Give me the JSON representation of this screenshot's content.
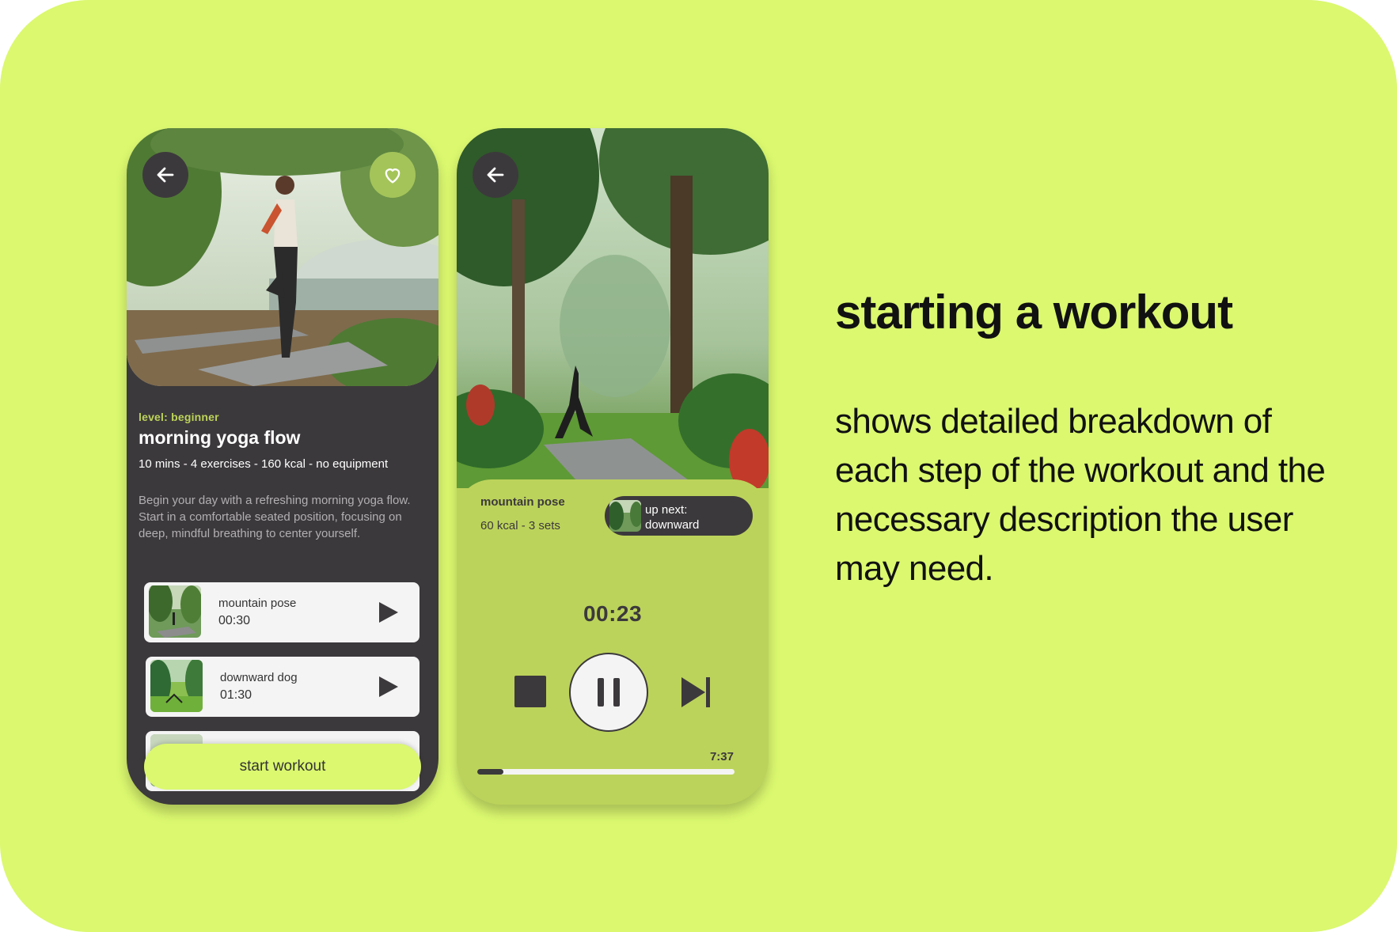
{
  "workout": {
    "level": "level: beginner",
    "title": "morning yoga flow",
    "meta": "10 mins - 4 exercises - 160 kcal - no equipment",
    "description": "Begin your day with a refreshing morning yoga flow. Start in a comfortable seated position, focusing on deep, mindful breathing to center yourself.",
    "exercises": [
      {
        "name": "mountain pose",
        "time": "00:30"
      },
      {
        "name": "downward dog",
        "time": "01:30"
      }
    ],
    "start_label": "start workout"
  },
  "player": {
    "current_name": "mountain pose",
    "current_meta": "60 kcal - 3 sets",
    "up_next_label": "up next:",
    "up_next_name": "downward",
    "timer": "00:23",
    "total": "7:37",
    "progress": 0.1
  },
  "text": {
    "headline": "starting a workout",
    "body": "shows detailed breakdown of each step of the workout and the necessary description the user may need."
  },
  "colors": {
    "background": "#dbf86f",
    "dark": "#3c393c",
    "accent": "#bcd35b",
    "light": "#f4f4f4"
  },
  "icons": [
    "back-arrow-icon",
    "heart-icon",
    "play-icon",
    "stop-icon",
    "pause-icon",
    "skip-next-icon"
  ]
}
